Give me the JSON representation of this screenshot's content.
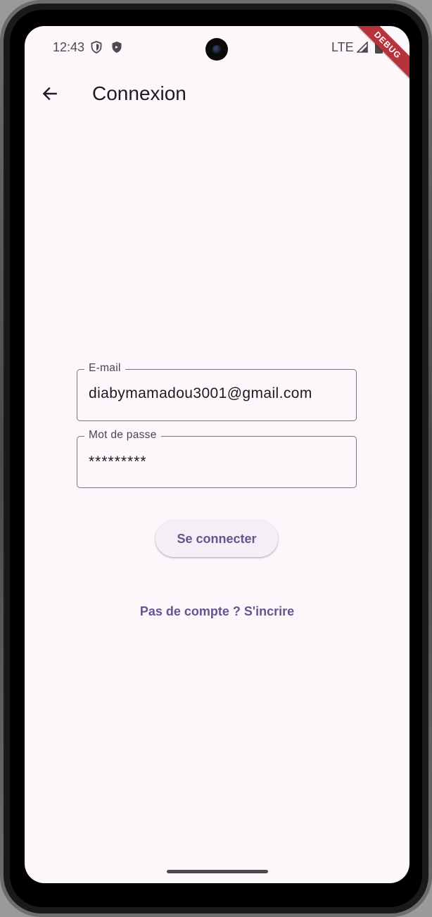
{
  "status_bar": {
    "time": "12:43",
    "network": "LTE",
    "icons": [
      "shield-outline-icon",
      "shield-filled-icon",
      "signal-icon",
      "battery-icon"
    ]
  },
  "debug_banner": "DEBUG",
  "app_bar": {
    "title": "Connexion",
    "back_icon": "arrow-back-icon"
  },
  "form": {
    "email": {
      "label": "E-mail",
      "value": "diabymamadou3001@gmail.com"
    },
    "password": {
      "label": "Mot de passe",
      "value": "*********"
    },
    "submit_label": "Se connecter",
    "signup_link": "Pas de compte ? S'incrire"
  },
  "colors": {
    "background": "#fdf7fc",
    "primary": "#65558f",
    "text": "#1c1b1f",
    "outline": "#7a757f",
    "debug_ribbon": "#b5343c"
  }
}
